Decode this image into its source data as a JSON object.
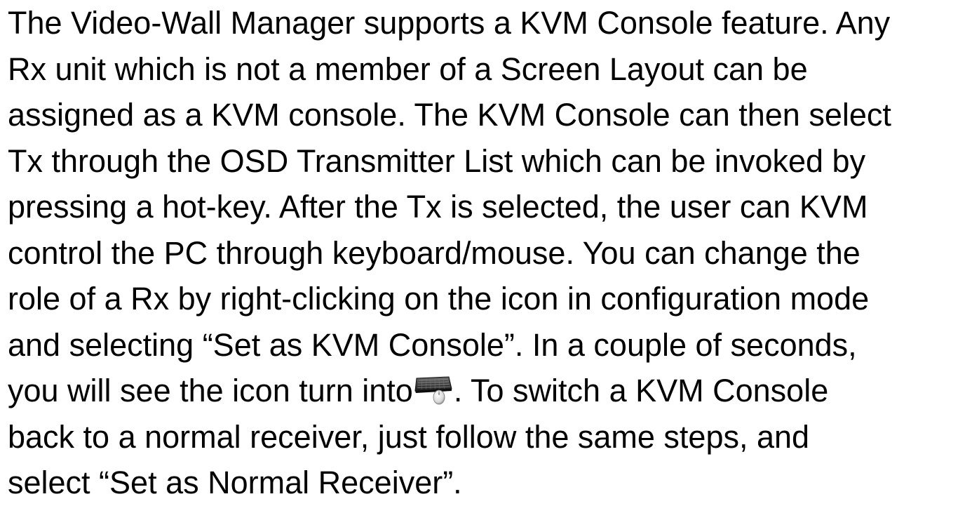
{
  "document": {
    "lines": [
      "The Video-Wall Manager supports a KVM Console feature. Any",
      "Rx unit which is not a member of a Screen Layout can be",
      "assigned as a KVM console. The KVM Console can then select",
      "Tx through the OSD Transmitter List which can be invoked by",
      "pressing a hot-key. After the Tx is selected, the user can KVM",
      "control the PC through keyboard/mouse. You can change the",
      "role of a Rx by right-clicking on the icon in configuration mode",
      "and selecting “Set as KVM Console”. In a couple of seconds,",
      {
        "before_icon": "you will see the icon turn into",
        "icon": "keyboard-mouse-icon",
        "after_icon": ". To switch a KVM Console"
      },
      "back to a normal receiver, just follow the same steps, and",
      "select “Set as Normal Receiver”."
    ]
  }
}
